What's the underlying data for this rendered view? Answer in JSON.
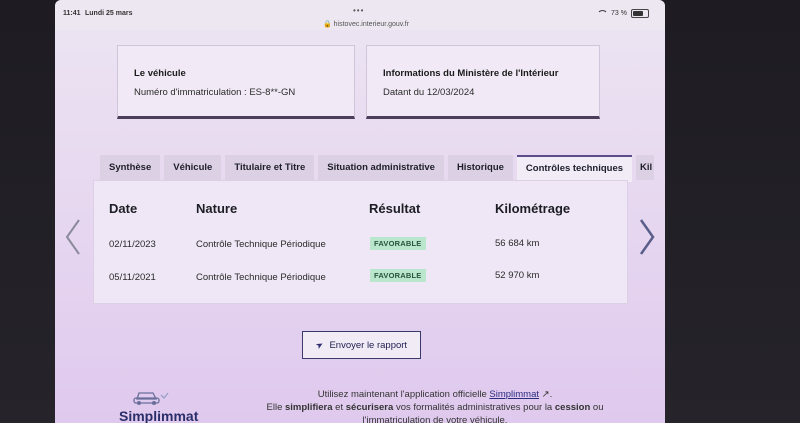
{
  "statusbar": {
    "time": "11:41",
    "date": "Lundi 25 mars",
    "dots": "•••",
    "url": "🔒 histovec.interieur.gouv.fr",
    "battery": "73 %",
    "battery_level": 0.73
  },
  "cards": [
    {
      "title": "Le véhicule",
      "subtitle": "Numéro d'immatriculation : ES-8**-GN"
    },
    {
      "title": "Informations du Ministère de l'Intérieur",
      "subtitle": "Datant du 12/03/2024"
    }
  ],
  "tabs": [
    "Synthèse",
    "Véhicule",
    "Titulaire et Titre",
    "Situation administrative",
    "Historique",
    "Contrôles techniques",
    "Kil"
  ],
  "active_tab": "Contrôles techniques",
  "table": {
    "headers": [
      "Date",
      "Nature",
      "Résultat",
      "Kilométrage"
    ],
    "rows": [
      {
        "date": "02/11/2023",
        "nature": "Contrôle Technique Périodique",
        "result": "FAVORABLE",
        "km": "56 684 km"
      },
      {
        "date": "05/11/2021",
        "nature": "Contrôle Technique Périodique",
        "result": "FAVORABLE",
        "km": "52 970 km"
      }
    ]
  },
  "report_button": {
    "label": "Envoyer le rapport"
  },
  "footer": {
    "line1_prefix": "Utilisez maintenant l'application officielle",
    "app_link": "Simplimmat",
    "line1_suffix": ".",
    "line2_a": "Elle",
    "line2_b": "simplifiera",
    "line2_c": "et",
    "line2_d": "sécurisera",
    "line2_e": "vos formalités administratives pour la",
    "line2_f": "cession",
    "line2_g": "ou",
    "line3": "l'immatriculation de votre véhicule."
  },
  "logo": {
    "text": "Simplimmat"
  },
  "colors": {
    "badge_bg": "#b9e6cd",
    "badge_text": "#27553a",
    "accent": "#4a3e5a",
    "link": "#2b2b80"
  }
}
